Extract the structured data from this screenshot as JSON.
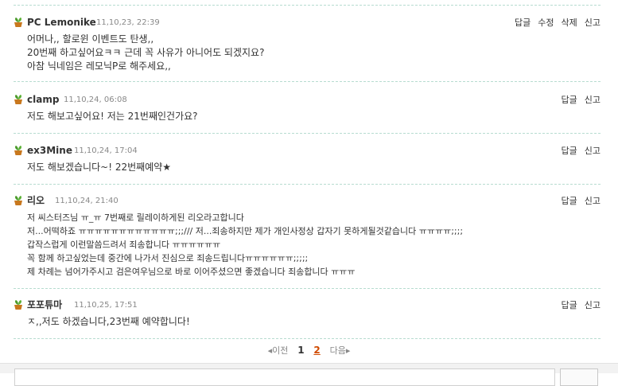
{
  "comments": [
    {
      "author": "PC Lemonike",
      "date": "11,10,23, 22:39",
      "actions": [
        "답글",
        "수정",
        "삭제",
        "신고"
      ],
      "lines": [
        "어머나,, 할로윈 이벤트도 탄생,,",
        "20번째 하고싶어요ㅋㅋ 근데 꼭 사유가 아니어도 되겠지요?",
        "아참 닉네임은 레모닉P로 해주세요,,"
      ]
    },
    {
      "author": "clamp",
      "date": "11,10,24, 06:08",
      "actions": [
        "답글",
        "신고"
      ],
      "lines": [
        "저도 해보고싶어요! 저는 21번째인건가요?"
      ]
    },
    {
      "author": "ex3Mine",
      "date": "11,10,24, 17:04",
      "actions": [
        "답글",
        "신고"
      ],
      "lines": [
        "저도 해보겠습니다~! 22번째예약★"
      ]
    },
    {
      "author": "리오",
      "date": "11,10,24, 21:40",
      "actions": [
        "답글",
        "신고"
      ],
      "lines": [
        "저 씨스터즈님 ㅠ_ㅠ 7번째로 릴레이하게된 리오라고합니다",
        "저...어떡하죠 ㅠㅠㅠㅠㅠㅠㅠㅠㅠㅠㅠㅠ;;;/// 저...죄송하지만 제가 개인사정상 갑자기 못하게될것같습니다 ㅠㅠㅠㅠ;;;;",
        "갑작스럽게 이런말씀드려서 죄송합니다 ㅠㅠㅠㅠㅠㅠ",
        "꼭 함께 하고싶었는데 중간에 나가서 진심으로 죄송드립니다ㅠㅠㅠㅠㅠㅠ;;;;;",
        "제 차례는 넘어가주시고 검은여우님으로 바로 이어주셨으면 좋겠습니다 죄송합니다 ㅠㅠㅠ"
      ]
    },
    {
      "author": "포포튜마",
      "date": "11,10,25, 17:51",
      "actions": [
        "답글",
        "신고"
      ],
      "lines": [
        "ㅈ,,저도 하겠습니다,23번째 예약합니다!"
      ]
    }
  ],
  "pagination": {
    "prev": "◂이전",
    "pages": [
      "1",
      "2"
    ],
    "current": "2",
    "next": "다음▸"
  },
  "colors": {
    "separator": "#b7dcd0",
    "current_page": "#d04a00",
    "icon_leaf": "#4a9a2a",
    "icon_pot": "#c8781e"
  },
  "icons": {
    "author_icon": "plant-pot-icon"
  }
}
